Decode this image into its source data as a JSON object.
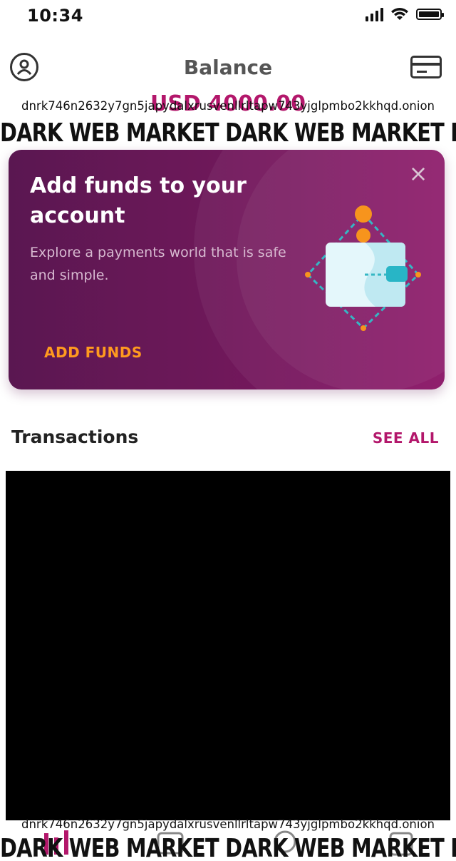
{
  "status_bar": {
    "time": "10:34"
  },
  "header": {
    "title": "Balance"
  },
  "balance": {
    "amount": "USD 4000.00"
  },
  "watermark": {
    "onion_address": "dnrk746n2632y7gn5japydalxrusvenllrltapw743yjglpmbo2kkhqd.onion",
    "banner_text": "DARK WEB MARKET DARK WEB MARKET DARK"
  },
  "promo": {
    "title": "Add funds to your account",
    "subtitle": "Explore a payments world that is safe and simple.",
    "cta": "ADD FUNDS",
    "close": "×"
  },
  "transactions": {
    "title": "Transactions",
    "see_all": "SEE ALL"
  },
  "colors": {
    "accent": "#b3176b",
    "promo_bg": "#6d1859",
    "cta": "#ff9a1f"
  }
}
